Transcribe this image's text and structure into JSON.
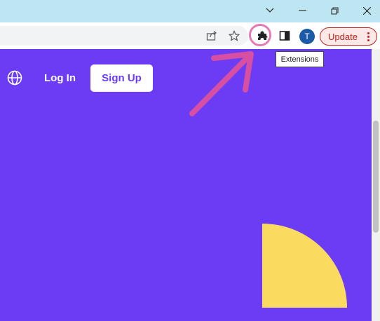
{
  "window": {
    "controls": [
      "chevron-down",
      "minimize",
      "restore",
      "close"
    ]
  },
  "toolbar": {
    "icons": [
      "share-icon",
      "star-icon",
      "puzzle-icon",
      "sidepanel-icon"
    ],
    "avatar_letter": "T",
    "update_label": "Update",
    "tooltip": "Extensions"
  },
  "site": {
    "login_label": "Log In",
    "signup_label": "Sign Up",
    "background_color": "#6c3cf5",
    "accent_shape_color": "#fadb5f"
  },
  "annotation": {
    "color": "#d64fa3"
  }
}
